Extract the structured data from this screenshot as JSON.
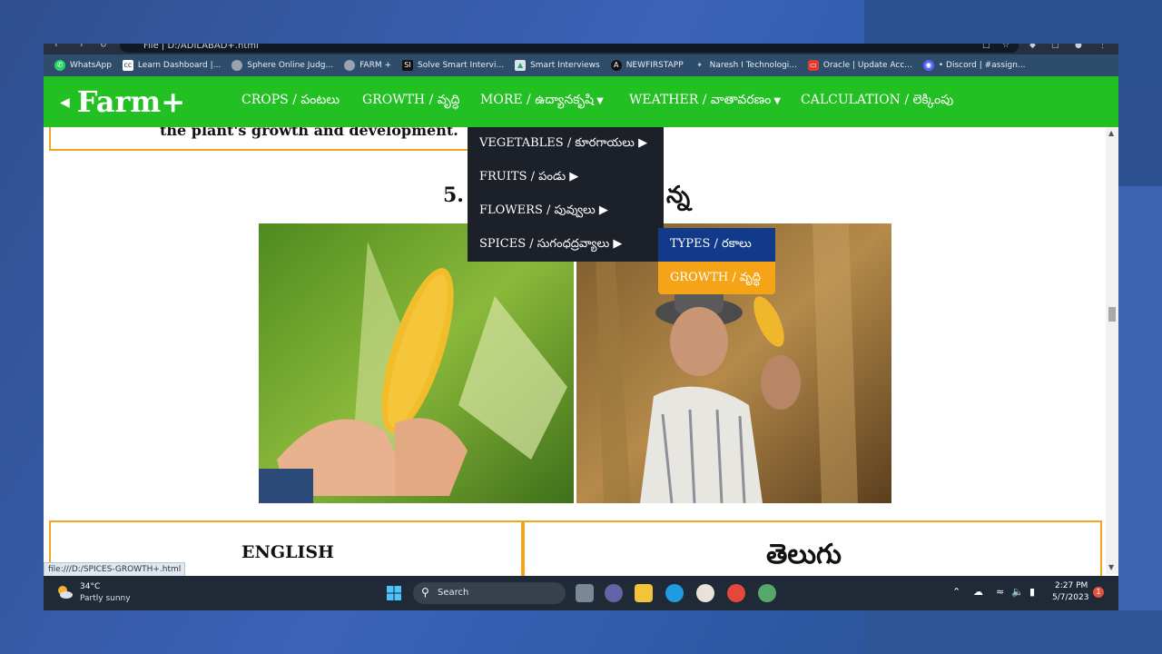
{
  "browser": {
    "url": "File | D:/ADILABAD+.html",
    "bookmarks": [
      {
        "label": "WhatsApp",
        "color": "#25d366",
        "icon": "whatsapp-icon"
      },
      {
        "label": "Learn Dashboard |...",
        "color": "#ffffff",
        "icon": "cc-icon"
      },
      {
        "label": "Sphere Online Judg...",
        "color": "#9aa4b0",
        "icon": "globe-icon"
      },
      {
        "label": "FARM +",
        "color": "#9aa4b0",
        "icon": "globe-icon"
      },
      {
        "label": "Solve Smart Intervi...",
        "color": "#111111",
        "icon": "si-icon"
      },
      {
        "label": "Smart Interviews",
        "color": "#dde4ec",
        "icon": "image-icon"
      },
      {
        "label": "NEWFIRSTAPP",
        "color": "#111111",
        "icon": "a-icon"
      },
      {
        "label": "Naresh I Technologi...",
        "color": "#2e4d6a",
        "icon": "naresh-icon"
      },
      {
        "label": "Oracle | Update Acc...",
        "color": "#e03c31",
        "icon": "oracle-icon"
      },
      {
        "label": "• Discord | #assign...",
        "color": "#5865f2",
        "icon": "discord-icon"
      }
    ]
  },
  "site": {
    "logo": "Farm+",
    "nav": {
      "crops": "CROPS / పంటలు",
      "growth": "GROWTH / వృద్ధి",
      "more": "MORE / ఉద్యానకృషి",
      "weather": "WEATHER / వాతావరణం",
      "calculation": "CALCULATION / లెక్కింపు"
    },
    "dropdown": {
      "vegetables": "VEGETABLES / కూరగాయలు",
      "fruits": "FRUITS / పండు",
      "flowers": "FLOWERS / పువ్వులు",
      "spices": "SPICES / సుగంధద్రవ్యాలు"
    },
    "submenu": {
      "types": "TYPES / రకాలు",
      "growth": "GROWTH / వృద్ధి"
    }
  },
  "content": {
    "box_text": "the plant's growth and development.",
    "heading_num": "5.",
    "heading_tail": "న్న",
    "lang_english": "ENGLISH",
    "lang_telugu": "తెలుగు"
  },
  "status_url": "file:///D:/SPICES-GROWTH+.html",
  "taskbar": {
    "temp": "34°C",
    "weather": "Partly sunny",
    "search": "Search",
    "time": "2:27 PM",
    "date": "5/7/2023",
    "notifications": "1"
  },
  "colors": {
    "nav_green": "#22c022",
    "dropdown_dark": "#1c2028",
    "submenu_blue": "#123a8a",
    "submenu_orange": "#f5a418",
    "border_orange": "#f2a51e"
  }
}
